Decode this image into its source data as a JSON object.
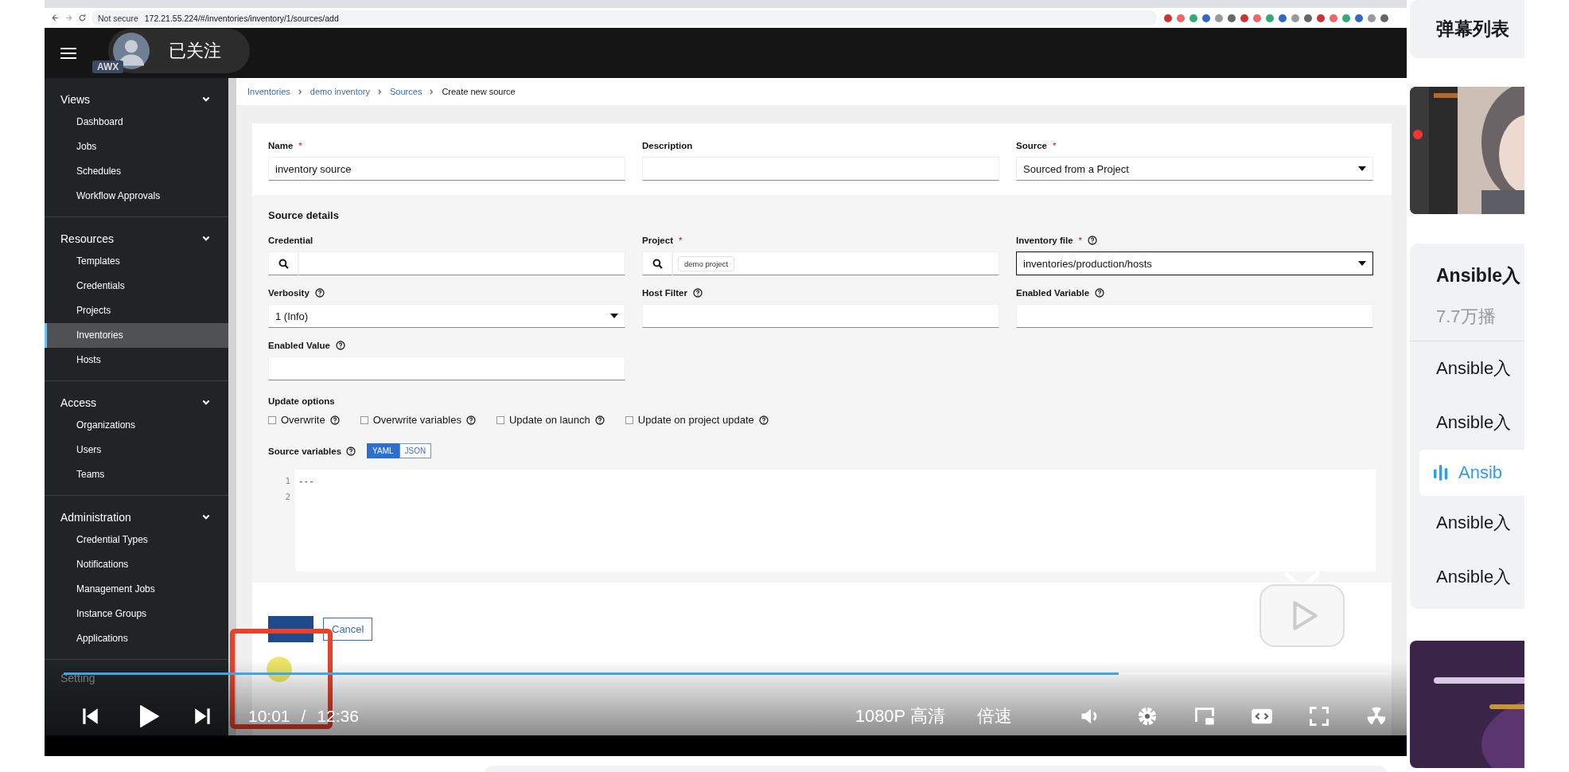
{
  "browser": {
    "security": "Not secure",
    "url": "172.21.55.224/#/inventories/inventory/1/sources/add"
  },
  "uploader": {
    "follow_label": "已关注"
  },
  "app": {
    "logo": "AWX"
  },
  "breadcrumb": [
    {
      "label": "Inventories",
      "link": true
    },
    {
      "label": "demo inventory",
      "link": true
    },
    {
      "label": "Sources",
      "link": true
    },
    {
      "label": "Create new source",
      "link": false
    }
  ],
  "sidebar": {
    "sections": [
      {
        "label": "Views",
        "expanded": true,
        "items": [
          {
            "label": "Dashboard",
            "selected": false
          },
          {
            "label": "Jobs",
            "selected": false
          },
          {
            "label": "Schedules",
            "selected": false
          },
          {
            "label": "Workflow Approvals",
            "selected": false
          }
        ]
      },
      {
        "label": "Resources",
        "expanded": true,
        "items": [
          {
            "label": "Templates",
            "selected": false
          },
          {
            "label": "Credentials",
            "selected": false
          },
          {
            "label": "Projects",
            "selected": false
          },
          {
            "label": "Inventories",
            "selected": true
          },
          {
            "label": "Hosts",
            "selected": false
          }
        ]
      },
      {
        "label": "Access",
        "expanded": true,
        "items": [
          {
            "label": "Organizations",
            "selected": false
          },
          {
            "label": "Users",
            "selected": false
          },
          {
            "label": "Teams",
            "selected": false
          }
        ]
      },
      {
        "label": "Administration",
        "expanded": true,
        "items": [
          {
            "label": "Credential Types",
            "selected": false
          },
          {
            "label": "Notifications",
            "selected": false
          },
          {
            "label": "Management Jobs",
            "selected": false
          },
          {
            "label": "Instance Groups",
            "selected": false
          },
          {
            "label": "Applications",
            "selected": false
          }
        ]
      }
    ],
    "last_section": "Setting"
  },
  "form": {
    "top_fields": [
      {
        "label": "Name",
        "required_mark": "*",
        "kind": "text",
        "value": "inventory source",
        "focused": false
      },
      {
        "label": "Description",
        "kind": "text",
        "focused": false
      },
      {
        "label": "Source",
        "required_mark": "*",
        "kind": "select",
        "value": "Sourced from a Project",
        "focused": false
      }
    ],
    "details_title": "Source details",
    "detail_fields": [
      {
        "label": "Credential",
        "kind": "lookup",
        "focused": false
      },
      {
        "label": "Project",
        "required_mark": "*",
        "kind": "lookup",
        "chip": "demo project",
        "focused": false
      },
      {
        "label": "Inventory file",
        "required_mark": "*",
        "help": true,
        "kind": "select",
        "value": "inventories/production/hosts",
        "focused": true
      },
      {
        "label": "Verbosity",
        "help": true,
        "kind": "select",
        "value": "1 (Info)",
        "focused": false
      },
      {
        "label": "Host Filter",
        "help": true,
        "kind": "text",
        "focused": false
      },
      {
        "label": "Enabled Variable",
        "help": true,
        "kind": "text",
        "focused": false
      },
      {
        "label": "Enabled Value",
        "help": true,
        "kind": "text",
        "focused": false
      }
    ],
    "update_options_label": "Update options",
    "update_options": [
      {
        "label": "Overwrite",
        "checked": false
      },
      {
        "label": "Overwrite variables",
        "checked": false
      },
      {
        "label": "Update on launch",
        "checked": false
      },
      {
        "label": "Update on project update",
        "checked": false
      }
    ],
    "source_variables_label": "Source variables",
    "formats": [
      {
        "label": "YAML",
        "selected": true
      },
      {
        "label": "JSON",
        "selected": false
      }
    ],
    "editor": {
      "line_numbers": [
        "1",
        "2"
      ],
      "code": "---"
    },
    "cancel_label": "Cancel"
  },
  "player": {
    "level": 0.795,
    "current_time": "10:01",
    "separator": "/",
    "total_time": "12:36",
    "quality": "1080P 高清",
    "speed": "倍速"
  },
  "side": {
    "danmaku_title": "弹幕列表",
    "playlist": {
      "title": "Ansible入",
      "views": "7.7万播",
      "items": [
        {
          "title": "Ansible入",
          "selected": false
        },
        {
          "title": "Ansible入",
          "selected": false
        },
        {
          "title": "Ansib",
          "selected": true
        },
        {
          "title": "Ansible入",
          "selected": false
        },
        {
          "title": "Ansible入",
          "selected": false
        }
      ]
    }
  }
}
